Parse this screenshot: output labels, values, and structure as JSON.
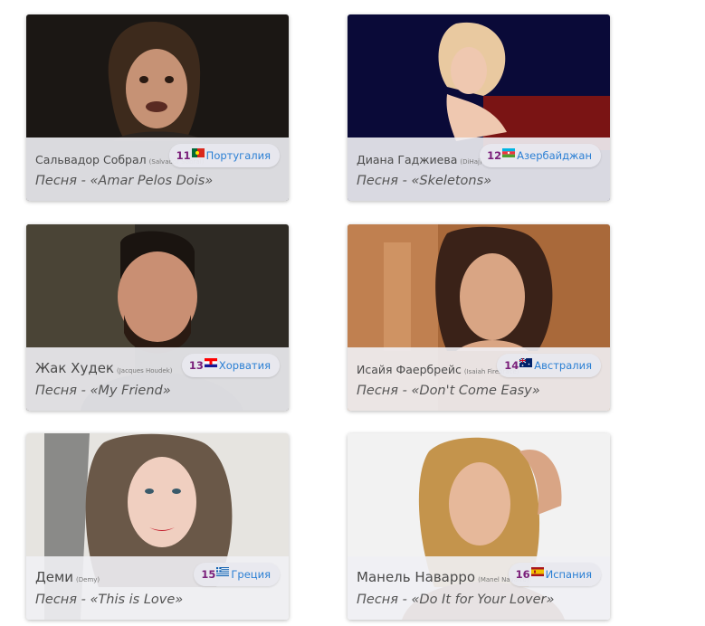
{
  "cards": [
    {
      "name": "Сальвадор Собрал",
      "original": "(Salvador Sobral)",
      "number": "11",
      "flag_icon": "portugal-flag-icon",
      "country": "Португалия",
      "song": "Песня - «Amar Pelos Dois»"
    },
    {
      "name": "Диана Гаджиева",
      "original": "(DiHaj)",
      "number": "12",
      "flag_icon": "azerbaijan-flag-icon",
      "country": "Азербайджан",
      "song": "Песня - «Skeletons»"
    },
    {
      "name": "Жак Худек",
      "original": "(Jacques Houdek)",
      "number": "13",
      "flag_icon": "croatia-flag-icon",
      "country": "Хорватия",
      "song": "Песня - «My Friend»"
    },
    {
      "name": "Исайя Фаербрейс",
      "original": "(Isaiah Firebrace)",
      "number": "14",
      "flag_icon": "australia-flag-icon",
      "country": "Австралия",
      "song": "Песня - «Don't Come Easy»"
    },
    {
      "name": "Деми",
      "original": "(Demy)",
      "number": "15",
      "flag_icon": "greece-flag-icon",
      "country": "Греция",
      "song": "Песня - «This is Love»"
    },
    {
      "name": "Манель Наварро",
      "original": "(Manel Navarro)",
      "number": "16",
      "flag_icon": "spain-flag-icon",
      "country": "Испания",
      "song": "Песня - «Do It for Your Lover»"
    }
  ]
}
